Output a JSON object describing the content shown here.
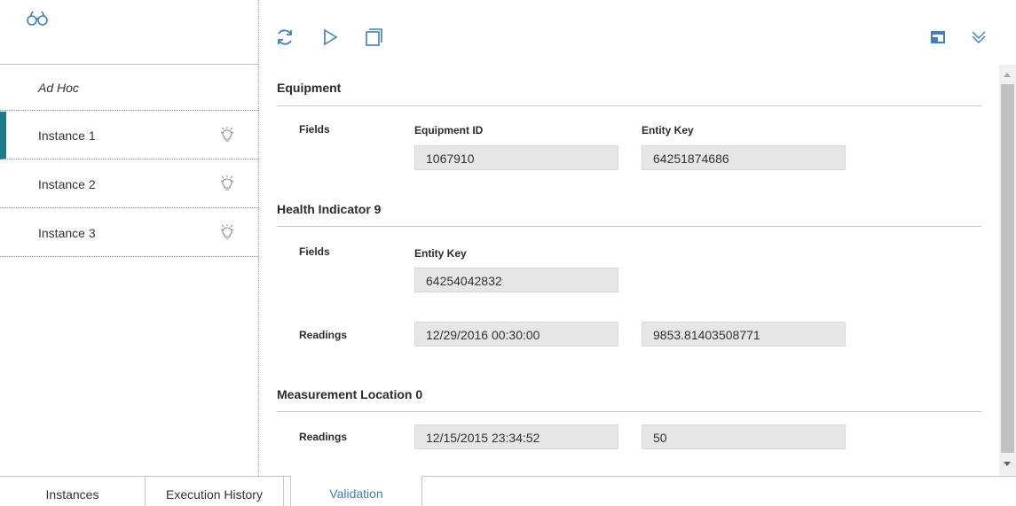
{
  "sidebar": {
    "search_icon": "binoculars-icon",
    "adhoc_label": "Ad Hoc",
    "instances": [
      {
        "label": "Instance 1",
        "active": true
      },
      {
        "label": "Instance 2",
        "active": false
      },
      {
        "label": "Instance 3",
        "active": false
      }
    ]
  },
  "toolbar": {
    "icons": [
      "refresh-icon",
      "run-icon",
      "copy-icon",
      "layout-icon",
      "expand-down-icon"
    ],
    "accent_color": "#3b7fc4"
  },
  "sections": [
    {
      "title": "Equipment",
      "rows": [
        {
          "label": "Fields",
          "fields": [
            {
              "label": "Equipment ID",
              "value": "1067910"
            },
            {
              "label": "Entity Key",
              "value": "64251874686"
            }
          ]
        }
      ]
    },
    {
      "title": "Health Indicator 9",
      "rows": [
        {
          "label": "Fields",
          "fields": [
            {
              "label": "Entity Key",
              "value": "64254042832"
            }
          ]
        },
        {
          "label": "Readings",
          "fields": [
            {
              "label": "",
              "value": "12/29/2016 00:30:00"
            },
            {
              "label": "",
              "value": "9853.81403508771"
            }
          ]
        }
      ]
    },
    {
      "title": "Measurement Location 0",
      "rows": [
        {
          "label": "Readings",
          "fields": [
            {
              "label": "",
              "value": "12/15/2015 23:34:52"
            },
            {
              "label": "",
              "value": "50"
            }
          ]
        }
      ]
    }
  ],
  "tabs": [
    {
      "label": "Instances",
      "active": false
    },
    {
      "label": "Execution History",
      "active": false
    },
    {
      "label": "Validation",
      "active": true
    }
  ],
  "colors": {
    "active_marker": "#1f7a8c",
    "icon_blue": "#3b7fc4"
  }
}
